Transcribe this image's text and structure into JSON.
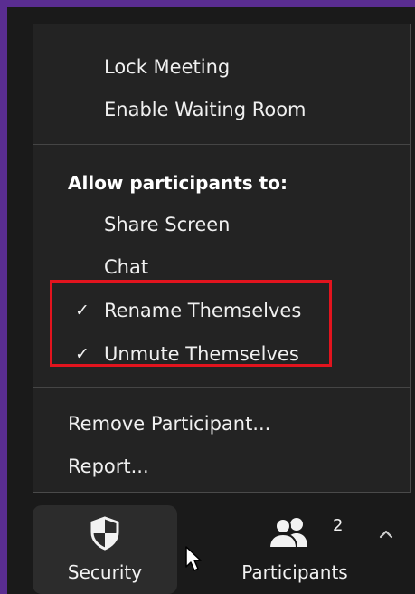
{
  "menu": {
    "items_top": [
      "Lock Meeting",
      "Enable Waiting Room"
    ],
    "section_heading": "Allow participants to:",
    "participant_options": [
      {
        "label": "Share Screen",
        "checked": false
      },
      {
        "label": "Chat",
        "checked": false
      },
      {
        "label": "Rename Themselves",
        "checked": true
      },
      {
        "label": "Unmute Themselves",
        "checked": true
      }
    ],
    "items_bottom": [
      "Remove Participant...",
      "Report..."
    ],
    "check_glyph": "✓"
  },
  "toolbar": {
    "security": {
      "label": "Security",
      "icon": "shield-icon"
    },
    "participants": {
      "label": "Participants",
      "count": "2",
      "icon": "participants-icon"
    },
    "expand_icon": "chevron-up-icon"
  },
  "colors": {
    "window_frame": "#5a2d91",
    "background": "#1a1a1a",
    "menu_background": "#232323",
    "highlight": "#e2141e"
  }
}
